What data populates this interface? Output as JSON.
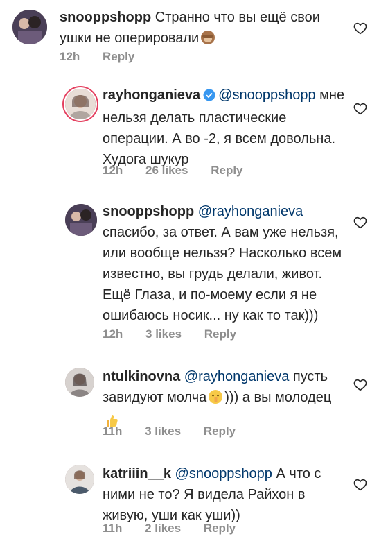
{
  "comments": [
    {
      "username": "snooppshopp",
      "verified": false,
      "mention": "",
      "text": "Странно что вы ещё свои ушки не оперировали",
      "emoji": "see-no-evil-monkey",
      "time": "12h",
      "likes": "",
      "reply": "Reply"
    },
    {
      "username": "rayhonganieva",
      "verified": true,
      "mention": "@snooppshopp",
      "text": "мне нельзя делать пластические операции. А во -2, я всем довольна. Худога шукур",
      "emoji": "",
      "time": "12h",
      "likes": "26 likes",
      "reply": "Reply"
    },
    {
      "username": "snooppshopp",
      "verified": false,
      "mention": "@rayhonganieva",
      "text": "спасибо, за ответ. А вам уже нельзя, или вообще нельзя? Насколько всем известно, вы грудь делали, живот. Ещё Глаза, и по-моему если я не ошибаюсь носик... ну как то так)))",
      "emoji": "",
      "time": "12h",
      "likes": "3 likes",
      "reply": "Reply"
    },
    {
      "username": "ntulkinovna",
      "verified": false,
      "mention": "@rayhonganieva",
      "text_before": "пусть завидуют молча",
      "text_after": "))) а вы молодец",
      "emoji": "shushing-face",
      "emoji2": "thumbs-up",
      "time": "11h",
      "likes": "3 likes",
      "reply": "Reply"
    },
    {
      "username": "katriiin__k",
      "verified": false,
      "mention": "@snooppshopp",
      "text": "А что с ними не то? Я видела Райхон в живую, уши как уши))",
      "emoji": "",
      "time": "11h",
      "likes": "2 likes",
      "reply": "Reply"
    }
  ],
  "icons": {
    "like": "heart-outline-icon",
    "verified": "verified-badge-icon"
  },
  "colors": {
    "mention": "#00376b",
    "meta": "#8e8e8e",
    "verified": "#3897f0"
  }
}
